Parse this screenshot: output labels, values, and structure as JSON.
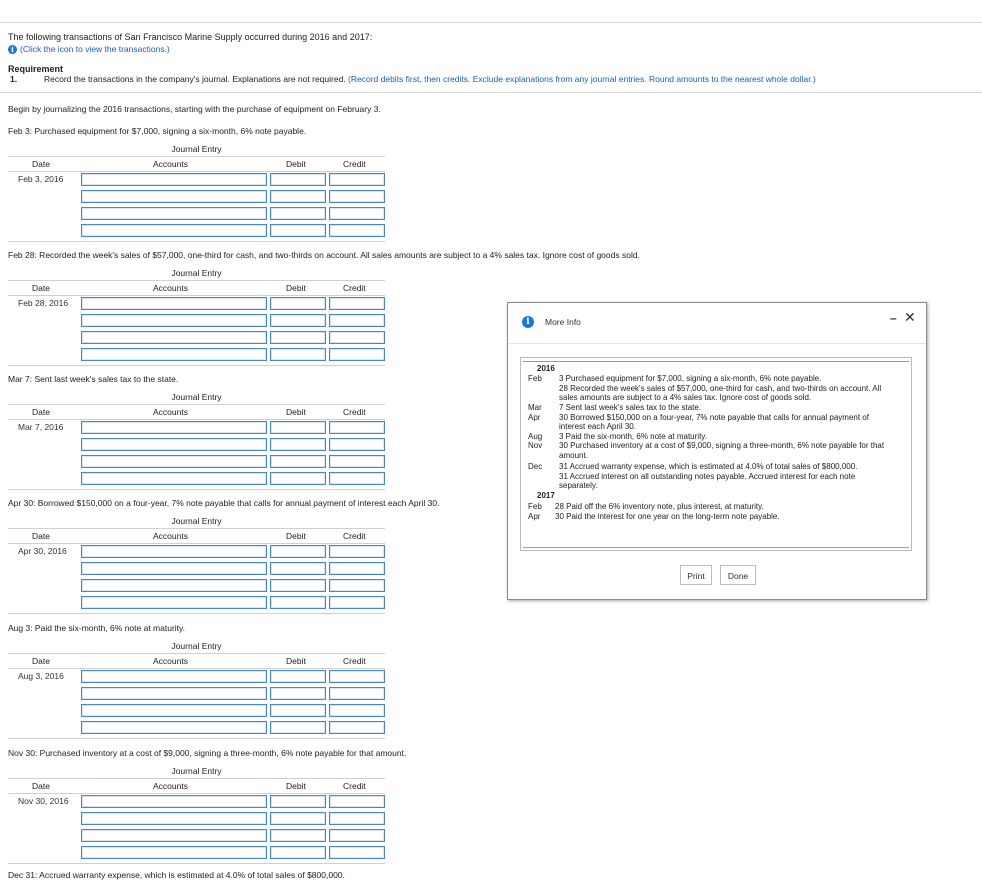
{
  "intro": "The following transactions of San Francisco Marine Supply occurred during 2016 and 2017:",
  "info_link": "(Click the icon to view the transactions.)",
  "requirement": {
    "title": "Requirement",
    "number": "1.",
    "text": "Record the transactions in the company's journal. Explanations are not required.",
    "hint": "(Record debits first, then credits. Exclude explanations from any journal entries. Round amounts to the nearest whole dollar.)"
  },
  "begin": "Begin by journalizing the 2016 transactions, starting with the purchase of equipment on February 3.",
  "journal": {
    "title": "Journal Entry",
    "col_date": "Date",
    "col_accounts": "Accounts",
    "col_debit": "Debit",
    "col_credit": "Credit"
  },
  "entries": [
    {
      "prompt": "Feb 3: Purchased equipment for $7,000, signing a six-month, 6% note payable.",
      "date": "Feb 3, 2016"
    },
    {
      "prompt": "Feb 28: Recorded the week's sales of $57,000, one-third for cash, and two-thirds on account. All sales amounts are subject to a 4% sales tax. Ignore cost of goods sold.",
      "date": "Feb 28, 2016"
    },
    {
      "prompt": "Mar 7: Sent last week's sales tax to the state.",
      "date": "Mar 7, 2016"
    },
    {
      "prompt": "Apr 30: Borrowed $150,000 on a four-year, 7% note payable that calls for annual payment of interest each April 30.",
      "date": "Apr 30, 2016"
    },
    {
      "prompt": "Aug 3: Paid the six-month, 6% note at maturity.",
      "date": "Aug 3, 2016"
    },
    {
      "prompt": "Nov 30: Purchased inventory at a cost of $9,000, signing a three-month, 6% note payable for that amount.",
      "date": "Nov 30, 2016"
    }
  ],
  "cutoff_prompt": "Dec 31: Accrued warranty expense, which is estimated at 4.0% of total sales of $800,000.",
  "modal": {
    "title": "More Info",
    "minimize": "–",
    "close": "✕",
    "year1": "2016",
    "year2": "2017",
    "lines": [
      {
        "month": "Feb",
        "text": "3 Purchased equipment for $7,000, signing a six-month, 6% note payable."
      },
      {
        "month": "",
        "text": "28 Recorded the week's sales of $57,000, one-third for cash, and two-thirds on account. All"
      },
      {
        "month": "",
        "text": "sales amounts are subject to a 4% sales tax. Ignore cost of goods sold."
      },
      {
        "month": "Mar",
        "text": "7 Sent last week's sales tax to the state."
      },
      {
        "month": "Apr",
        "text": "30 Borrowed $150,000 on a four-year, 7% note payable that calls for annual payment of"
      },
      {
        "month": "",
        "text": "interest each April 30."
      },
      {
        "month": "Aug",
        "text": "3 Paid the six-month, 6% note at maturity."
      },
      {
        "month": "Nov",
        "text": "30 Purchased inventory at a cost of $9,000, signing a three-month, 6% note payable for that"
      },
      {
        "month": "",
        "text": "amount."
      },
      {
        "month": "Dec",
        "text": "31 Accrued warranty expense, which is estimated at 4.0% of total sales of $800,000."
      },
      {
        "month": "",
        "text": "31 Accrued interest on all outstanding notes payable. Accrued interest for each note"
      },
      {
        "month": "",
        "text": "separately."
      }
    ],
    "lines2017": [
      {
        "month": "Feb",
        "text": "28 Paid off the 6% inventory note, plus interest, at maturity."
      },
      {
        "month": "Apr",
        "text": "30 Paid the interest for one year on the long-term note payable."
      }
    ],
    "print_label": "Print",
    "done_label": "Done"
  }
}
